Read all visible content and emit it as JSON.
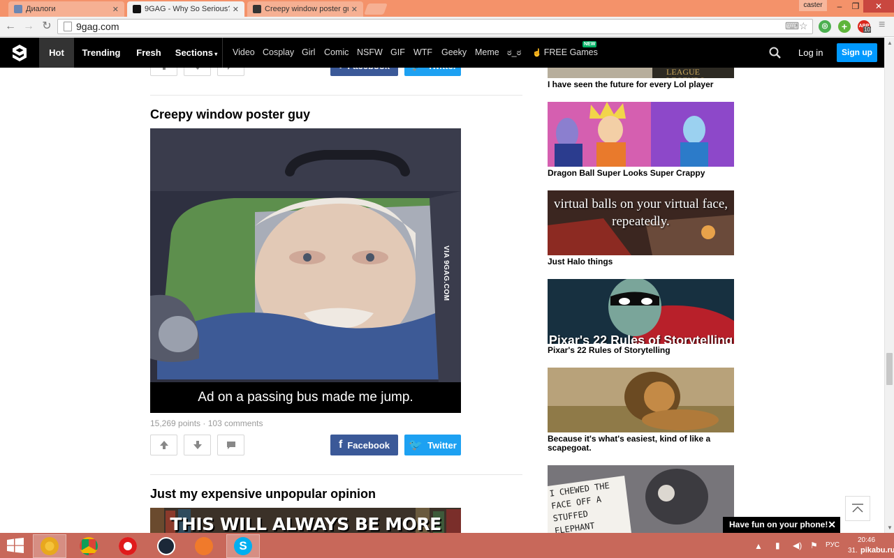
{
  "browser": {
    "tabs": [
      {
        "label": "Диалоги"
      },
      {
        "label": "9GAG - Why So Serious?"
      },
      {
        "label": "Creepy window poster gu"
      }
    ],
    "user": "caster",
    "url": "9gag.com",
    "ext_badge": "10"
  },
  "site": {
    "nav_main": [
      "Hot",
      "Trending",
      "Fresh",
      "Sections"
    ],
    "nav_sub": [
      "Video",
      "Cosplay",
      "Girl",
      "Comic",
      "NSFW",
      "GIF",
      "WTF",
      "Geeky",
      "Meme",
      "ಠ_ಠ",
      "FREE Games"
    ],
    "new_badge": "NEW",
    "login": "Log in",
    "signup": "Sign up"
  },
  "share": {
    "facebook": "Facebook",
    "twitter": "Twitter"
  },
  "post": {
    "title": "Creepy window poster guy",
    "caption": "Ad on a passing bus made me jump.",
    "watermark": "VIA 9GAG.COM",
    "points": "15,269 points",
    "separator": "·",
    "comments": "103 comments"
  },
  "post2": {
    "title": "Just my expensive unpopular opinion",
    "image_text": "THIS WILL ALWAYS BE MORE"
  },
  "sidebar": [
    {
      "label": "I have seen the future for every Lol player",
      "image_text": "LEAGUE LEGENDS"
    },
    {
      "label": "Dragon Ball Super Looks Super Crappy"
    },
    {
      "label": "Just Halo things",
      "image_text": "virtual balls on your virtual face, repeatedly."
    },
    {
      "label": "Pixar's 22 Rules of Storytelling",
      "image_text": "Pixar's 22 Rules of Storytelling"
    },
    {
      "label": "Because it's what's easiest, kind of like a scapegoat."
    },
    {
      "label": "",
      "image_text": "I CHEWED THE FACE OFF A STUFFED ELEPHANT"
    }
  ],
  "toast": {
    "text": "Have fun on your phone!",
    "close": "✕"
  },
  "tray": {
    "lang": "РУС",
    "time": "20:46",
    "date": "31.",
    "watermark": "pikabu.ru"
  }
}
